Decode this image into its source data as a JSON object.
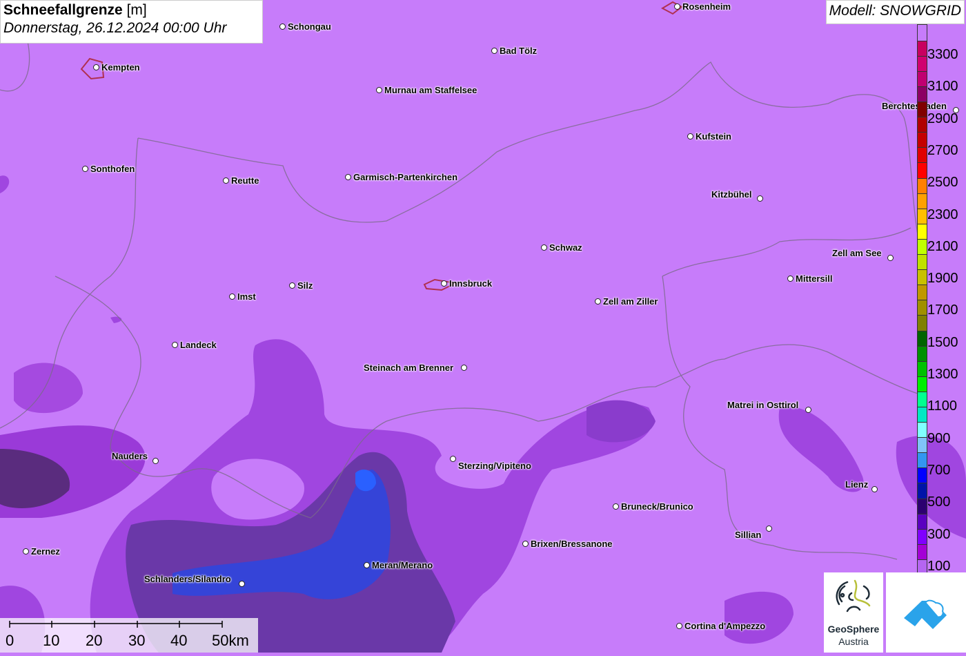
{
  "title": {
    "parameter": "Schneefallgrenze",
    "unit": "[m]",
    "datetime": "Donnerstag, 26.12.2024 00:00 Uhr"
  },
  "model": "Modell: SNOWGRID",
  "cities": [
    {
      "name": "Rosenheim"
    },
    {
      "name": "Schongau"
    },
    {
      "name": "Bad Tölz"
    },
    {
      "name": "Kempten"
    },
    {
      "name": "Murnau am Staffelsee"
    },
    {
      "name": "Berchtesgaden"
    },
    {
      "name": "Kufstein"
    },
    {
      "name": "Sonthofen"
    },
    {
      "name": "Reutte"
    },
    {
      "name": "Garmisch-Partenkirchen"
    },
    {
      "name": "Kitzbühel"
    },
    {
      "name": "Schwaz"
    },
    {
      "name": "Zell am See"
    },
    {
      "name": "Mittersill"
    },
    {
      "name": "Silz"
    },
    {
      "name": "Innsbruck"
    },
    {
      "name": "Imst"
    },
    {
      "name": "Zell am Ziller"
    },
    {
      "name": "Landeck"
    },
    {
      "name": "Steinach am Brenner"
    },
    {
      "name": "Matrei in Osttirol"
    },
    {
      "name": "Nauders"
    },
    {
      "name": "Sterzing/Vipiteno"
    },
    {
      "name": "Lienz"
    },
    {
      "name": "Bruneck/Brunico"
    },
    {
      "name": "Sillian"
    },
    {
      "name": "Brixen/Bressanone"
    },
    {
      "name": "Zernez"
    },
    {
      "name": "Meran/Merano"
    },
    {
      "name": "Schlanders/Silandro"
    },
    {
      "name": "Cortina d'Ampezzo"
    }
  ],
  "legend": {
    "labels": [
      "3300",
      "3100",
      "2900",
      "2700",
      "2500",
      "2300",
      "2100",
      "1900",
      "1700",
      "1500",
      "1300",
      "1100",
      "900",
      "700",
      "500",
      "300",
      "100"
    ],
    "colors": [
      "#b565f2",
      "#a400d6",
      "#8000ff",
      "#5a00c0",
      "#2c0070",
      "#0014a8",
      "#0000ff",
      "#3396f0",
      "#80c4f8",
      "#80ffff",
      "#00e8c4",
      "#00ff90",
      "#00ee00",
      "#00c000",
      "#009000",
      "#006400",
      "#808000",
      "#a09000",
      "#c09800",
      "#c8c000",
      "#c0e000",
      "#c0ff00",
      "#ffff00",
      "#ffc000",
      "#ffa000",
      "#ff8000",
      "#ff0000",
      "#e00000",
      "#c40000",
      "#b00000",
      "#800000",
      "#8c0064",
      "#c00070",
      "#d00070",
      "#c80060"
    ]
  },
  "scale_bar": {
    "labels": [
      "0",
      "10",
      "20",
      "30",
      "40",
      "50km"
    ]
  },
  "logos": {
    "geosphere_line1": "GeoSphere",
    "geosphere_line2": "Austria"
  }
}
